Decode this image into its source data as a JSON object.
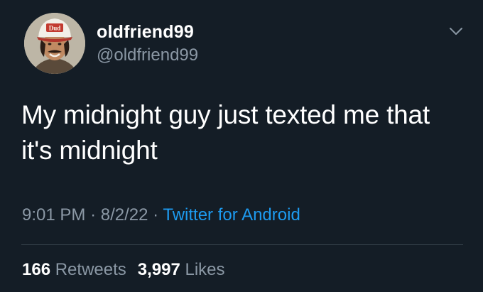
{
  "author": {
    "display_name": "oldfriend99",
    "handle": "@oldfriend99",
    "avatar_cap_text": "Dud"
  },
  "tweet": {
    "text": "My midnight guy just texted me that\nit's midnight",
    "time": "9:01 PM",
    "date": "8/2/22",
    "separator": "·",
    "source": "Twitter for Android"
  },
  "stats": {
    "retweets_count": "166",
    "retweets_label": "Retweets",
    "likes_count": "3,997",
    "likes_label": "Likes"
  },
  "icons": {
    "menu": "chevron-down-icon"
  },
  "colors": {
    "background": "#141d26",
    "primary_text": "#ffffff",
    "secondary_text": "#8b98a5",
    "link": "#1d9bf0",
    "divider": "#38444d"
  }
}
